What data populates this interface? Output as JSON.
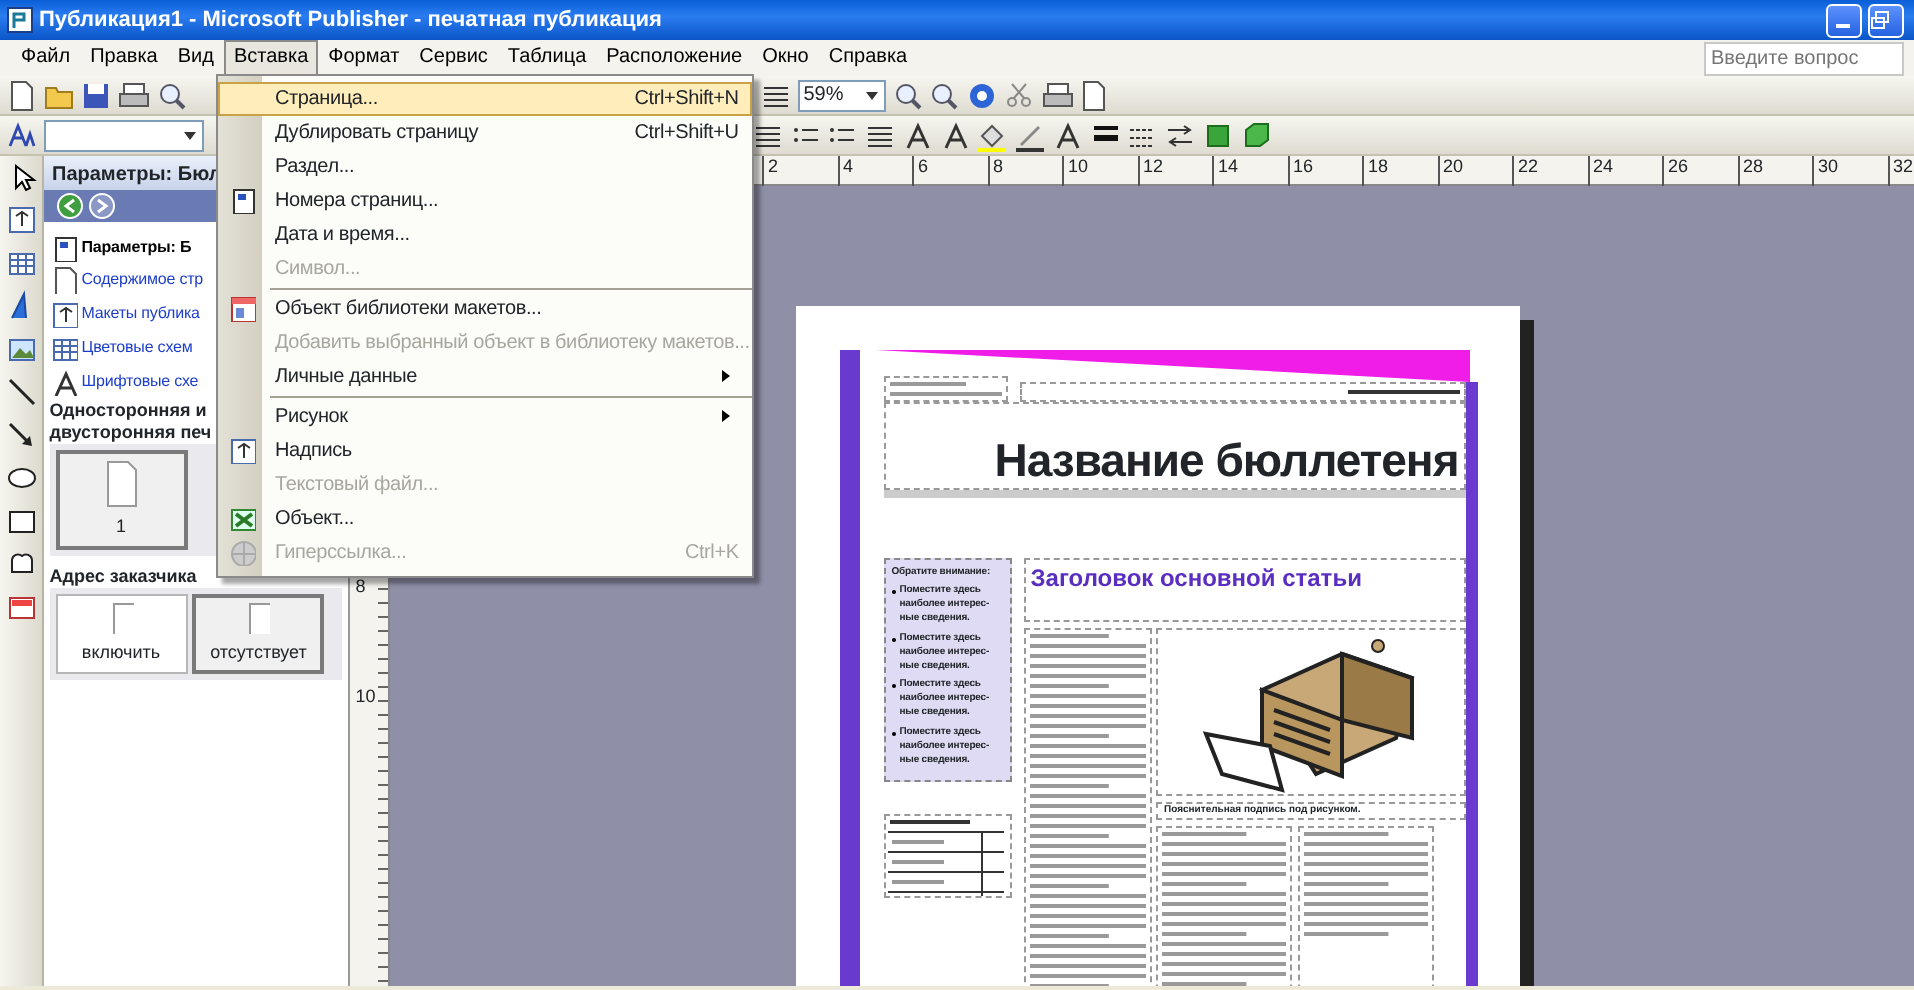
{
  "window": {
    "title": "Публикация1 - Microsoft Publisher - печатная публикация"
  },
  "menu_bar": [
    {
      "label": "Файл",
      "selected": false
    },
    {
      "label": "Правка",
      "selected": false
    },
    {
      "label": "Вид",
      "selected": false
    },
    {
      "label": "Вставка",
      "selected": true
    },
    {
      "label": "Формат",
      "selected": false
    },
    {
      "label": "Сервис",
      "selected": false
    },
    {
      "label": "Таблица",
      "selected": false
    },
    {
      "label": "Расположение",
      "selected": false
    },
    {
      "label": "Окно",
      "selected": false
    },
    {
      "label": "Справка",
      "selected": false
    }
  ],
  "help_search": {
    "placeholder": "Введите вопрос"
  },
  "toolbar": {
    "zoom": "59%"
  },
  "insert_menu": [
    {
      "label": "Страница...",
      "shortcut": "Ctrl+Shift+N",
      "kind": "plain",
      "selected": true,
      "disabled": false,
      "separator_before": false
    },
    {
      "label": "Дублировать страницу",
      "shortcut": "Ctrl+Shift+U",
      "kind": "plain",
      "selected": false,
      "disabled": false,
      "separator_before": false
    },
    {
      "label": "Раздел...",
      "kind": "plain",
      "selected": false,
      "disabled": false,
      "separator_before": false
    },
    {
      "label": "Номера страниц...",
      "kind": "with_icon",
      "selected": false,
      "disabled": false,
      "separator_before": false
    },
    {
      "label": "Дата и время...",
      "kind": "plain",
      "selected": false,
      "disabled": false,
      "separator_before": false
    },
    {
      "label": "Символ...",
      "kind": "plain",
      "selected": false,
      "disabled": true,
      "separator_before": false
    },
    {
      "label": "Объект библиотеки макетов...",
      "kind": "with_icon",
      "selected": false,
      "disabled": false,
      "separator_before": true
    },
    {
      "label": "Добавить выбранный объект в библиотеку макетов...",
      "kind": "plain",
      "selected": false,
      "disabled": true,
      "separator_before": false
    },
    {
      "label": "Личные данные",
      "kind": "submenu",
      "selected": false,
      "disabled": false,
      "separator_before": false
    },
    {
      "label": "Рисунок",
      "kind": "submenu",
      "selected": false,
      "disabled": false,
      "separator_before": true
    },
    {
      "label": "Надпись",
      "kind": "with_icon",
      "selected": false,
      "disabled": false,
      "separator_before": false
    },
    {
      "label": "Текстовый файл...",
      "kind": "plain",
      "selected": false,
      "disabled": true,
      "separator_before": false
    },
    {
      "label": "Объект...",
      "kind": "with_icon",
      "selected": false,
      "disabled": false,
      "separator_before": false
    },
    {
      "label": "Гиперссылка...",
      "shortcut": "Ctrl+K",
      "kind": "with_icon",
      "selected": false,
      "disabled": true,
      "separator_before": false
    }
  ],
  "task_pane": {
    "title": "Параметры: Бюл",
    "links": [
      {
        "label": "Параметры: Б",
        "kind": "heading"
      },
      {
        "label": "Содержимое стр",
        "kind": "link"
      },
      {
        "label": "Макеты публика",
        "kind": "link"
      },
      {
        "label": "Цветовые схем",
        "kind": "link"
      },
      {
        "label": "Шрифтовые схе",
        "kind": "link"
      }
    ],
    "print_title": [
      "Односторонняя и",
      "двусторонняя печ"
    ],
    "print_options": [
      {
        "label": "1",
        "selected": true
      }
    ],
    "address_title": "Адрес заказчика",
    "address_options": [
      {
        "label": "включить",
        "selected": false
      },
      {
        "label": "отсутствует",
        "selected": true
      }
    ]
  },
  "ruler": {
    "horizontal": [
      "2",
      "4",
      "6",
      "8",
      "10",
      "12",
      "14",
      "16",
      "18",
      "20",
      "22",
      "24",
      "26",
      "28",
      "30",
      "32"
    ],
    "vertical": [
      "8",
      "10"
    ]
  },
  "document": {
    "title": "Название бюллетеня",
    "headline": "Заголовок основной статьи",
    "sidebar": {
      "heading": "Обратите внимание:",
      "bullets": [
        "Поместите здесь наиболее интерес-ные сведения.",
        "Поместите здесь наиболее интерес-ные сведения.",
        "Поместите здесь наиболее интерес-ные сведения.",
        "Поместите здесь наиболее интерес-ные сведения."
      ]
    },
    "caption": "Пояснительная подпись под рисунком."
  }
}
